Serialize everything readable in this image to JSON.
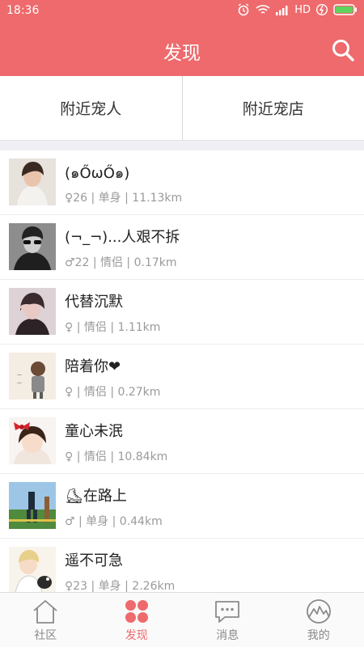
{
  "status_bar": {
    "time": "18:36",
    "network": "HD"
  },
  "header": {
    "title": "发现"
  },
  "tabs": [
    {
      "label": "附近宠人"
    },
    {
      "label": "附近宠店"
    }
  ],
  "users": [
    {
      "name": "(๑ŐωŐ๑)",
      "meta": "♀26 | 单身 | 11.13km"
    },
    {
      "name": "(¬_¬)...人艰不拆",
      "meta": "♂22 | 情侣 | 0.17km"
    },
    {
      "name": "代替沉默",
      "meta": "♀ | 情侣 | 1.11km"
    },
    {
      "name": "陪着你❤",
      "meta": "♀ | 情侣 | 0.27km"
    },
    {
      "name": "童心未泯",
      "meta": "♀ | 情侣 | 10.84km"
    },
    {
      "name": "⛸在路上",
      "meta": "♂ | 单身 | 0.44km"
    },
    {
      "name": "遥不可急",
      "meta": "♀23 | 单身 | 2.26km"
    }
  ],
  "bottom_nav": [
    {
      "label": "社区",
      "icon": "house-icon",
      "active": false
    },
    {
      "label": "发现",
      "icon": "discover-circles-icon",
      "active": true
    },
    {
      "label": "消息",
      "icon": "chat-bubble-icon",
      "active": false
    },
    {
      "label": "我的",
      "icon": "profile-icon",
      "active": false
    }
  ],
  "colors": {
    "accent": "#ee6a6c",
    "inactive": "#8a8a8a"
  }
}
